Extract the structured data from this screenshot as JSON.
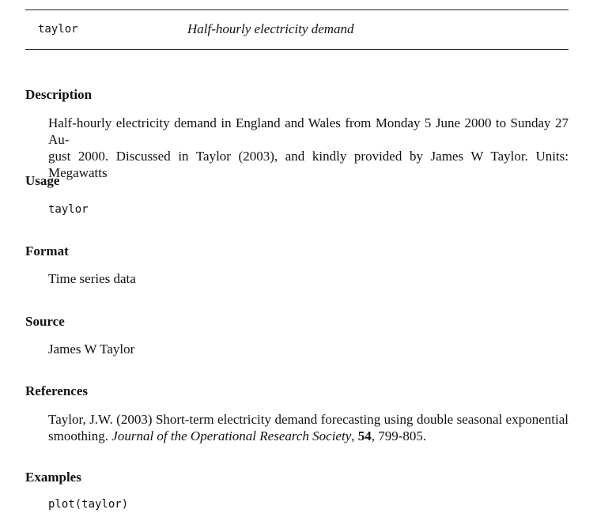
{
  "header": {
    "name": "taylor",
    "title": "Half-hourly electricity demand"
  },
  "description": {
    "heading": "Description",
    "line1": "Half-hourly electricity demand in England and Wales from Monday 5 June 2000 to Sunday 27 Au-",
    "line2": "gust 2000. Discussed in Taylor (2003), and kindly provided by James W Taylor. Units: Megawatts"
  },
  "usage": {
    "heading": "Usage",
    "code": "taylor"
  },
  "format": {
    "heading": "Format",
    "text": "Time series data"
  },
  "source": {
    "heading": "Source",
    "text": "James W Taylor"
  },
  "references": {
    "heading": "References",
    "line1": "Taylor, J.W. (2003) Short-term electricity demand forecasting using double seasonal exponential",
    "line2_prefix": "smoothing. ",
    "journal": "Journal of the Operational Research Society",
    "comma": ", ",
    "volume": "54",
    "pages": ", 799-805."
  },
  "examples": {
    "heading": "Examples",
    "code": "plot(taylor)"
  }
}
